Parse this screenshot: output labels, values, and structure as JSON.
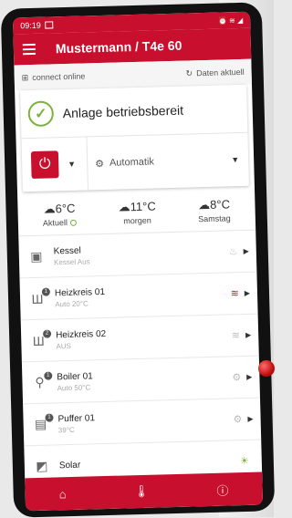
{
  "status": {
    "time": "09:19",
    "icons": "⏰ ≋ ◢"
  },
  "appbar": {
    "title": "Mustermann / T4e 60"
  },
  "connection": {
    "status": "connect online",
    "update": "Daten aktuell"
  },
  "system": {
    "status": "Anlage betriebsbereit"
  },
  "controls": {
    "mode": "Automatik"
  },
  "weather": [
    {
      "temp": "6°C",
      "label": "Aktuell",
      "icon": "cloud-icon"
    },
    {
      "temp": "11°C",
      "label": "morgen",
      "icon": "cloud-icon"
    },
    {
      "temp": "8°C",
      "label": "Samstag",
      "icon": "cloud-icon"
    }
  ],
  "rows": [
    {
      "name": "Kessel",
      "sub": "Kessel Aus",
      "status_icon": "flame-icon"
    },
    {
      "name": "Heizkreis 01",
      "sub": "Auto 20°C",
      "status_icon": "heat-waves-icon",
      "badge": "1"
    },
    {
      "name": "Heizkreis 02",
      "sub": "AUS",
      "status_icon": "heat-waves-icon",
      "badge": "2"
    },
    {
      "name": "Boiler 01",
      "sub": "Auto 50°C",
      "status_icon": "tap-icon",
      "badge": "1"
    },
    {
      "name": "Puffer 01",
      "sub": "39°C",
      "status_icon": "tap-icon",
      "badge": "1"
    },
    {
      "name": "Solar",
      "sub": "",
      "status_icon": "solar-icon"
    }
  ],
  "colors": {
    "accent": "#c8102e",
    "ok": "#7bb13c"
  }
}
